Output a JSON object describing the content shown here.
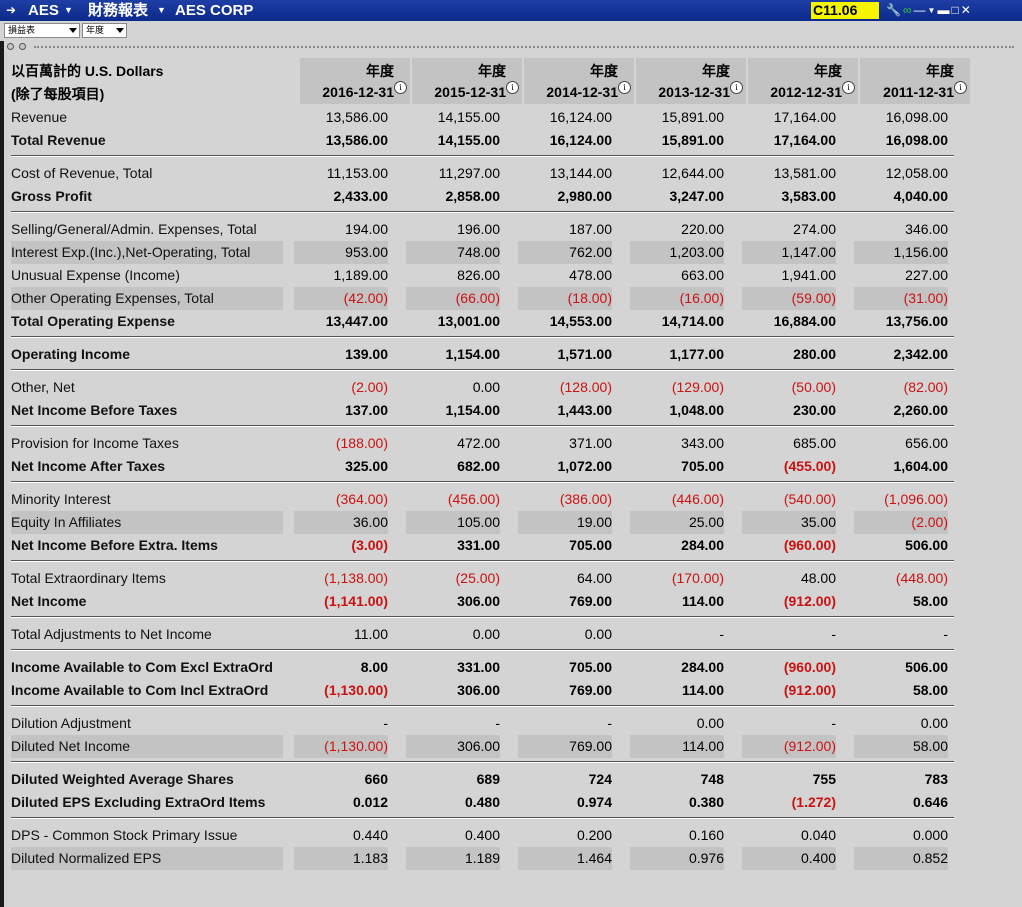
{
  "titlebar": {
    "symbol": "AES",
    "menu": "財務報表",
    "company": "AES CORP",
    "ticker_box": "C11.06"
  },
  "toolbar": {
    "statement_select": "損益表",
    "period_select": "年度"
  },
  "header": {
    "label_line1": "以百萬計的 U.S. Dollars",
    "label_line2": "(除了每股項目)",
    "period_label": "年度",
    "dates": [
      "2016-12-31",
      "2015-12-31",
      "2014-12-31",
      "2013-12-31",
      "2012-12-31",
      "2011-12-31"
    ]
  },
  "rows": [
    {
      "label": "Revenue",
      "values": [
        "13,586.00",
        "14,155.00",
        "16,124.00",
        "15,891.00",
        "17,164.00",
        "16,098.00"
      ],
      "bold": false
    },
    {
      "label": "Total Revenue",
      "values": [
        "13,586.00",
        "14,155.00",
        "16,124.00",
        "15,891.00",
        "17,164.00",
        "16,098.00"
      ],
      "bold": true
    },
    {
      "label": "Cost of Revenue, Total",
      "values": [
        "11,153.00",
        "11,297.00",
        "13,144.00",
        "12,644.00",
        "13,581.00",
        "12,058.00"
      ],
      "bold": false
    },
    {
      "label": "Gross Profit",
      "values": [
        "2,433.00",
        "2,858.00",
        "2,980.00",
        "3,247.00",
        "3,583.00",
        "4,040.00"
      ],
      "bold": true
    },
    {
      "label": "Selling/General/Admin. Expenses, Total",
      "values": [
        "194.00",
        "196.00",
        "187.00",
        "220.00",
        "274.00",
        "346.00"
      ],
      "bold": false
    },
    {
      "label": "Interest Exp.(Inc.),Net-Operating, Total",
      "values": [
        "953.00",
        "748.00",
        "762.00",
        "1,203.00",
        "1,147.00",
        "1,156.00"
      ],
      "bold": false
    },
    {
      "label": "Unusual Expense (Income)",
      "values": [
        "1,189.00",
        "826.00",
        "478.00",
        "663.00",
        "1,941.00",
        "227.00"
      ],
      "bold": false
    },
    {
      "label": "Other Operating Expenses, Total",
      "values": [
        "(42.00)",
        "(66.00)",
        "(18.00)",
        "(16.00)",
        "(59.00)",
        "(31.00)"
      ],
      "bold": false
    },
    {
      "label": "Total Operating Expense",
      "values": [
        "13,447.00",
        "13,001.00",
        "14,553.00",
        "14,714.00",
        "16,884.00",
        "13,756.00"
      ],
      "bold": true
    },
    {
      "label": "Operating Income",
      "values": [
        "139.00",
        "1,154.00",
        "1,571.00",
        "1,177.00",
        "280.00",
        "2,342.00"
      ],
      "bold": true
    },
    {
      "label": "Other, Net",
      "values": [
        "(2.00)",
        "0.00",
        "(128.00)",
        "(129.00)",
        "(50.00)",
        "(82.00)"
      ],
      "bold": false
    },
    {
      "label": "Net Income Before Taxes",
      "values": [
        "137.00",
        "1,154.00",
        "1,443.00",
        "1,048.00",
        "230.00",
        "2,260.00"
      ],
      "bold": true
    },
    {
      "label": "Provision for Income Taxes",
      "values": [
        "(188.00)",
        "472.00",
        "371.00",
        "343.00",
        "685.00",
        "656.00"
      ],
      "bold": false
    },
    {
      "label": "Net Income After Taxes",
      "values": [
        "325.00",
        "682.00",
        "1,072.00",
        "705.00",
        "(455.00)",
        "1,604.00"
      ],
      "bold": true
    },
    {
      "label": "Minority Interest",
      "values": [
        "(364.00)",
        "(456.00)",
        "(386.00)",
        "(446.00)",
        "(540.00)",
        "(1,096.00)"
      ],
      "bold": false
    },
    {
      "label": "Equity In Affiliates",
      "values": [
        "36.00",
        "105.00",
        "19.00",
        "25.00",
        "35.00",
        "(2.00)"
      ],
      "bold": false
    },
    {
      "label": "Net Income Before Extra. Items",
      "values": [
        "(3.00)",
        "331.00",
        "705.00",
        "284.00",
        "(960.00)",
        "506.00"
      ],
      "bold": true
    },
    {
      "label": "Total Extraordinary Items",
      "values": [
        "(1,138.00)",
        "(25.00)",
        "64.00",
        "(170.00)",
        "48.00",
        "(448.00)"
      ],
      "bold": false
    },
    {
      "label": "Net Income",
      "values": [
        "(1,141.00)",
        "306.00",
        "769.00",
        "114.00",
        "(912.00)",
        "58.00"
      ],
      "bold": true
    },
    {
      "label": "Total Adjustments to Net Income",
      "values": [
        "11.00",
        "0.00",
        "0.00",
        "-",
        "-",
        "-"
      ],
      "bold": false
    },
    {
      "label": "Income Available to Com Excl ExtraOrd",
      "values": [
        "8.00",
        "331.00",
        "705.00",
        "284.00",
        "(960.00)",
        "506.00"
      ],
      "bold": true
    },
    {
      "label": "Income Available to Com Incl ExtraOrd",
      "values": [
        "(1,130.00)",
        "306.00",
        "769.00",
        "114.00",
        "(912.00)",
        "58.00"
      ],
      "bold": true
    },
    {
      "label": "Dilution Adjustment",
      "values": [
        "-",
        "-",
        "-",
        "0.00",
        "-",
        "0.00"
      ],
      "bold": false
    },
    {
      "label": "Diluted Net Income",
      "values": [
        "(1,130.00)",
        "306.00",
        "769.00",
        "114.00",
        "(912.00)",
        "58.00"
      ],
      "bold": false
    },
    {
      "label": "Diluted Weighted Average Shares",
      "values": [
        "660",
        "689",
        "724",
        "748",
        "755",
        "783"
      ],
      "bold": true
    },
    {
      "label": "Diluted EPS Excluding ExtraOrd Items",
      "values": [
        "0.012",
        "0.480",
        "0.974",
        "0.380",
        "(1.272)",
        "0.646"
      ],
      "bold": true
    },
    {
      "label": "DPS - Common Stock Primary Issue",
      "values": [
        "0.440",
        "0.400",
        "0.200",
        "0.160",
        "0.040",
        "0.000"
      ],
      "bold": false
    },
    {
      "label": "Diluted Normalized EPS",
      "values": [
        "1.183",
        "1.189",
        "1.464",
        "0.976",
        "0.400",
        "0.852"
      ],
      "bold": false
    }
  ],
  "colors": {
    "titlebar": "#0c2a8a",
    "negative": "#cc1111",
    "ticker_bg": "#f5f500",
    "background": "#d4d4d4",
    "shade": "#c3c3c3"
  },
  "icons": [
    "wrench-icon",
    "link-icon",
    "minus-icon",
    "dropdown-icon",
    "minimize-icon",
    "maximize-icon",
    "close-icon"
  ]
}
